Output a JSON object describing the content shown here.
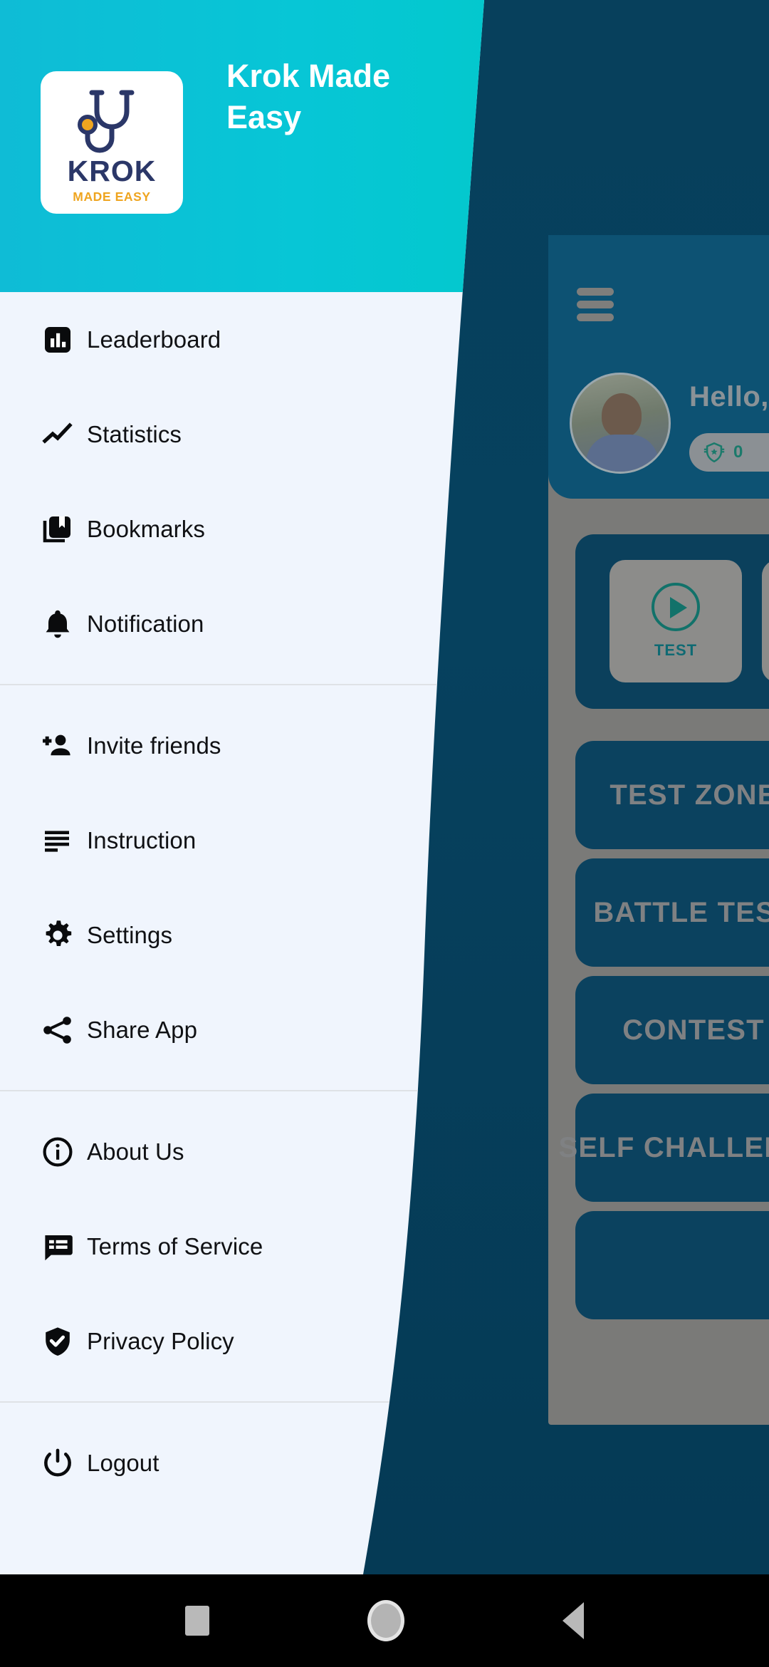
{
  "app": {
    "title": "Krok Made Easy",
    "logo": {
      "word": "KROK",
      "subtitle": "MADE EASY"
    },
    "accent": "#07c6d6",
    "drawer_bg": "#f0f5fd",
    "background_color": "#06415e"
  },
  "drawer": {
    "groups": [
      {
        "items": [
          {
            "label": "Leaderboard",
            "icon": "bar-chart-icon"
          },
          {
            "label": "Statistics",
            "icon": "trending-up-icon"
          },
          {
            "label": "Bookmarks",
            "icon": "bookmarks-icon"
          },
          {
            "label": "Notification",
            "icon": "bell-icon"
          }
        ]
      },
      {
        "items": [
          {
            "label": "Invite friends",
            "icon": "person-add-icon"
          },
          {
            "label": "Instruction",
            "icon": "list-lines-icon"
          },
          {
            "label": "Settings",
            "icon": "gear-icon"
          },
          {
            "label": "Share App",
            "icon": "share-icon"
          }
        ]
      },
      {
        "items": [
          {
            "label": "About Us",
            "icon": "info-circle-icon"
          },
          {
            "label": "Terms of Service",
            "icon": "speech-list-icon"
          },
          {
            "label": "Privacy Policy",
            "icon": "shield-check-icon"
          }
        ]
      },
      {
        "items": [
          {
            "label": "Logout",
            "icon": "power-icon"
          }
        ]
      }
    ]
  },
  "background_screen": {
    "menu_icon": "hamburger-icon",
    "greeting": "Hello,",
    "coin_badge": {
      "icon": "rank-shield-icon",
      "value": "0"
    },
    "tiles": [
      {
        "label": "TEST",
        "icon": "play-circle-icon"
      }
    ],
    "buttons": [
      {
        "label": "TEST ZONE"
      },
      {
        "label": "BATTLE TEST"
      },
      {
        "label": "CONTEST"
      },
      {
        "label": "SELF CHALLENGE"
      }
    ]
  },
  "system_nav": {
    "recents": "recents-square-icon",
    "home": "home-circle-icon",
    "back": "back-triangle-icon"
  }
}
